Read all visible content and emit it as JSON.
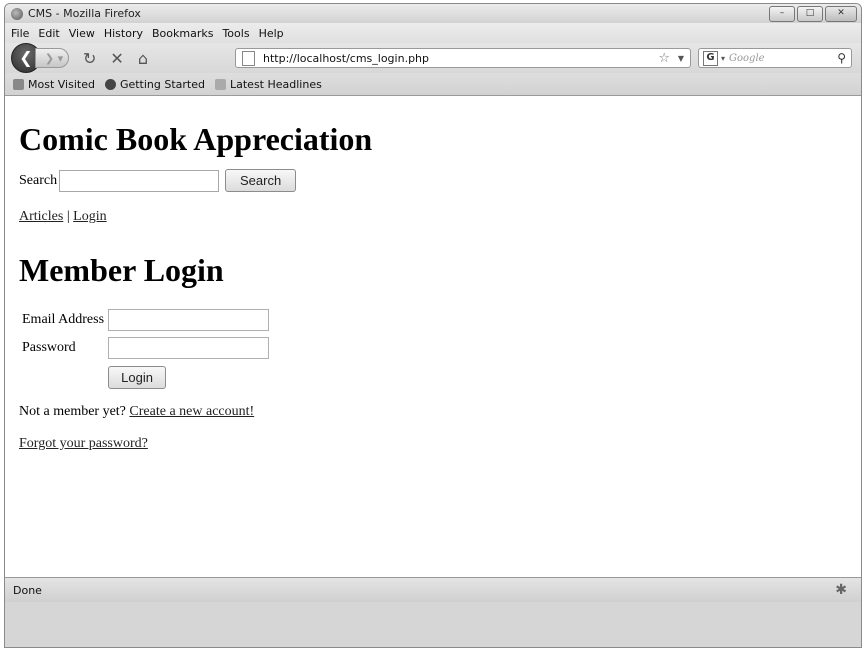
{
  "window": {
    "title": "CMS - Mozilla Firefox"
  },
  "menu": [
    "File",
    "Edit",
    "View",
    "History",
    "Bookmarks",
    "Tools",
    "Help"
  ],
  "nav": {
    "url": "http://localhost/cms_login.php",
    "search_placeholder": "Google"
  },
  "bookmarks": [
    "Most Visited",
    "Getting Started",
    "Latest Headlines"
  ],
  "page": {
    "site_title": "Comic Book Appreciation",
    "search_label": "Search",
    "search_value": "",
    "search_button": "Search",
    "links": {
      "articles": "Articles",
      "separator": "|",
      "login": "Login"
    },
    "heading": "Member Login",
    "email_label": "Email Address",
    "email_value": "",
    "password_label": "Password",
    "password_value": "",
    "login_button": "Login",
    "member_prompt": "Not a member yet?",
    "create_link": "Create a new account!",
    "forgot_link": "Forgot your password?"
  },
  "status": {
    "text": "Done"
  }
}
